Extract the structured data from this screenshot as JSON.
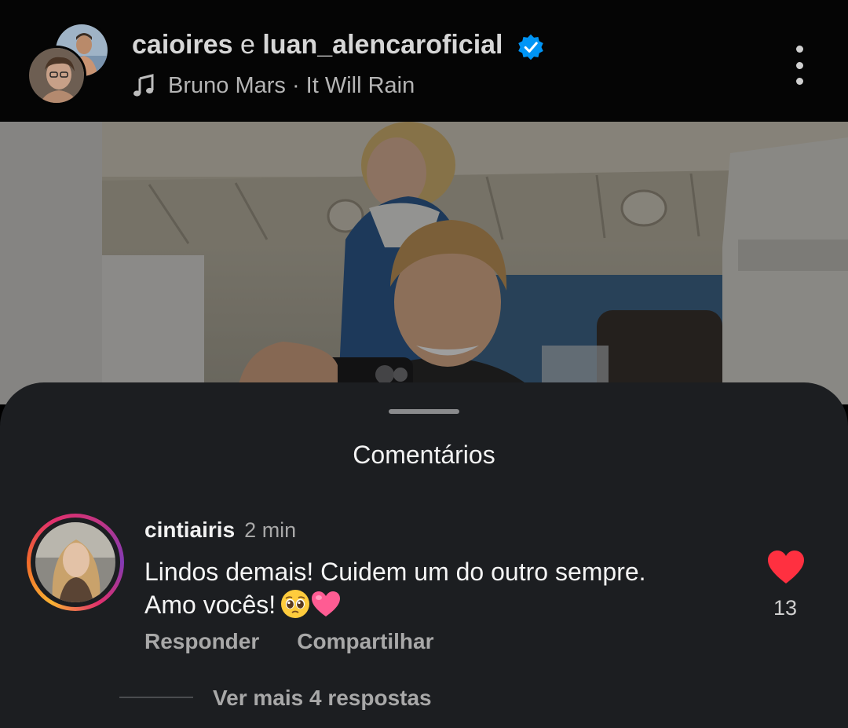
{
  "header": {
    "user1": "caioires",
    "joiner": "e",
    "user2": "luan_alencaroficial",
    "verified_icon": "verified-badge-icon",
    "music": "Bruno Mars · It Will Rain",
    "music_icon": "music-note-icon",
    "more_icon": "more-vertical-icon"
  },
  "comments_sheet": {
    "title": "Comentários",
    "comment": {
      "username": "cintiairis",
      "time": "2 min",
      "text_line1": "Lindos demais! Cuidem um do outro sempre.",
      "text_line2": "Amo vocês!",
      "emojis": [
        "pleading-face",
        "pink-heart"
      ],
      "likes": "13",
      "like_icon": "heart-icon"
    },
    "actions": {
      "reply": "Responder",
      "share": "Compartilhar"
    },
    "view_replies": "Ver mais 4 respostas"
  },
  "colors": {
    "sheet_background": "#1c1e21",
    "header_background": "#050505",
    "like_red": "#ff3040",
    "verified_blue": "#0095f6",
    "secondary_text": "#a8a8a8"
  }
}
